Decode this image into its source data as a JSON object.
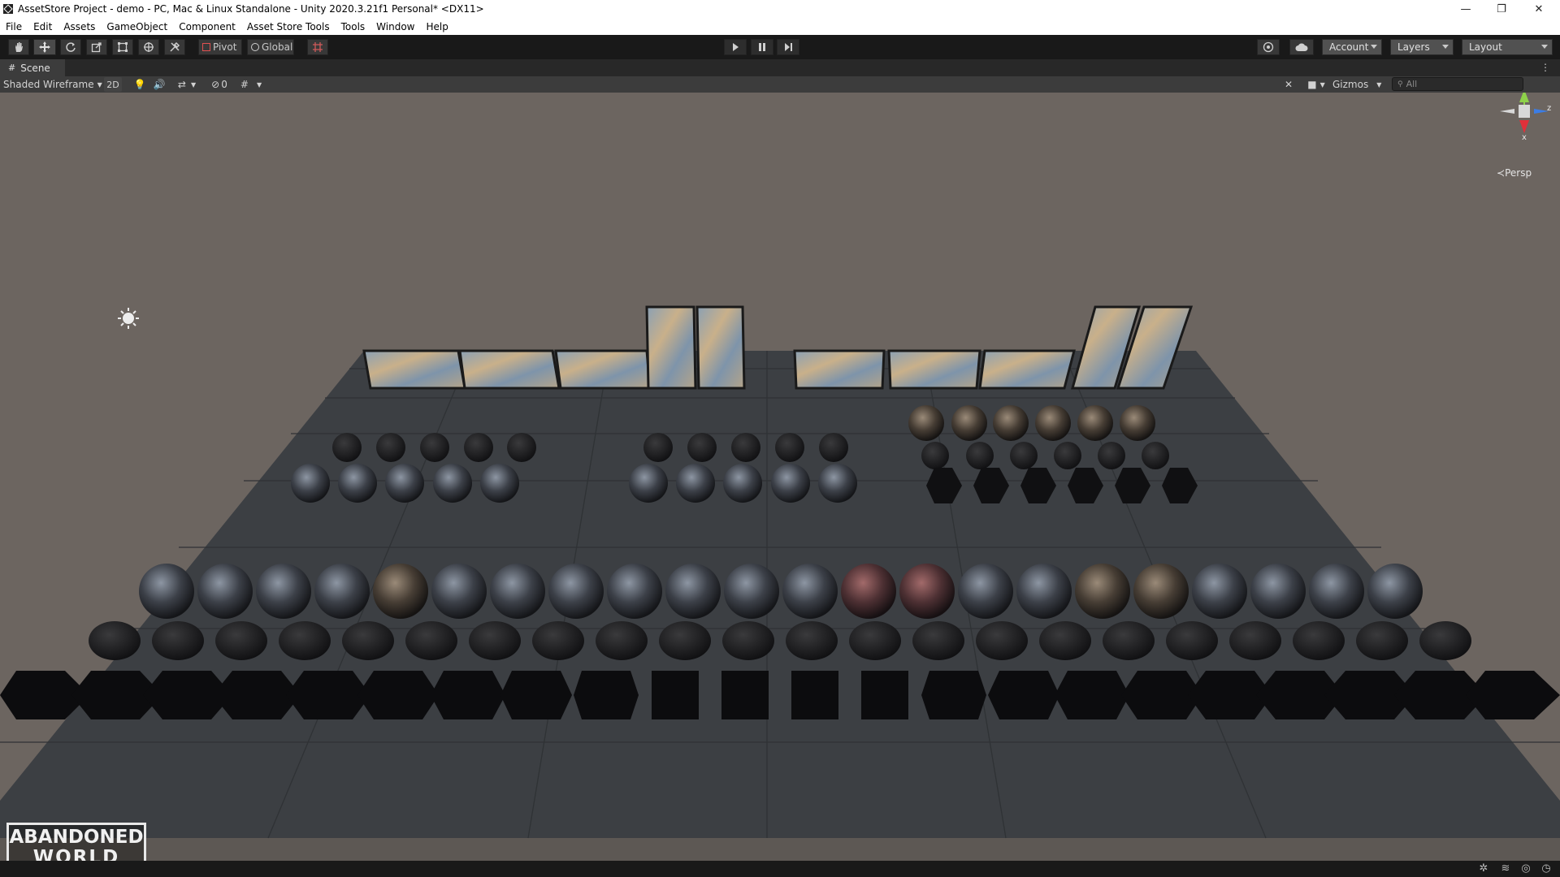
{
  "window": {
    "title": "AssetStore Project - demo - PC, Mac & Linux Standalone - Unity 2020.3.21f1 Personal* <DX11>",
    "minimize": "—",
    "maximize": "❐",
    "close": "✕"
  },
  "menu": [
    "File",
    "Edit",
    "Assets",
    "GameObject",
    "Component",
    "Asset Store Tools",
    "Tools",
    "Window",
    "Help"
  ],
  "toolbar": {
    "tools": [
      "hand-tool-icon",
      "move-tool-icon",
      "rotate-tool-icon",
      "scale-tool-icon",
      "rect-tool-icon",
      "transform-tool-icon",
      "custom-tool-icon"
    ],
    "pivot": "Pivot",
    "global": "Global",
    "account": "Account",
    "layers": "Layers",
    "layout": "Layout"
  },
  "scene_tab": {
    "label": "Scene"
  },
  "scene_toolbar": {
    "draw_mode": "Shaded Wireframe",
    "mode_2d": "2D",
    "hidden_count": "0",
    "gizmos": "Gizmos",
    "search_placeholder": "All"
  },
  "gizmo": {
    "y": "y",
    "z": "z",
    "x": "x",
    "projection": "Persp"
  },
  "watermark": {
    "line1": "ABANDONED",
    "line2": "WORLD"
  },
  "colors": {
    "sky": "#6c6560",
    "floor": "#3c3f43",
    "axis_y": "#8ed14a",
    "axis_x": "#e0303a",
    "axis_z": "#3b7de6"
  }
}
